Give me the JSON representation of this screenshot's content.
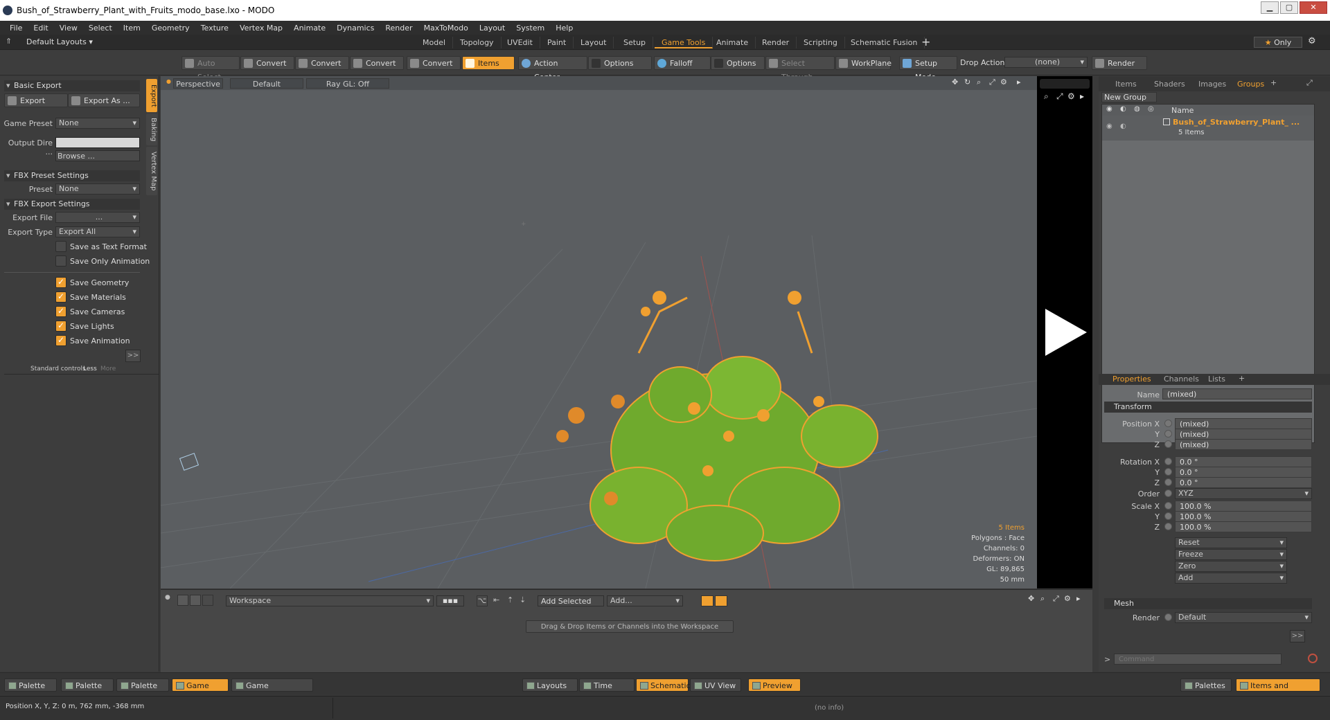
{
  "window": {
    "title": "Bush_of_Strawberry_Plant_with_Fruits_modo_base.lxo - MODO"
  },
  "menu": [
    "File",
    "Edit",
    "View",
    "Select",
    "Item",
    "Geometry",
    "Texture",
    "Vertex Map",
    "Animate",
    "Dynamics",
    "Render",
    "MaxToModo",
    "Layout",
    "System",
    "Help"
  ],
  "layouts": {
    "label": "Default Layouts",
    "tabs": [
      "Model",
      "Topology",
      "UVEdit",
      "Paint",
      "Layout",
      "Setup",
      "Game Tools",
      "Animate",
      "Render",
      "Scripting",
      "Schematic Fusion"
    ],
    "active": "Game Tools",
    "only": "Only"
  },
  "toolbar": {
    "auto_select": "Auto Select",
    "convert": "Convert",
    "items": "Items",
    "action_center": "Action Center",
    "options": "Options",
    "falloff": "Falloff",
    "select_through": "Select Through",
    "workplane": "WorkPlane",
    "setup_mode": "Setup Mode",
    "drop_action": "Drop Action",
    "drop_value": "(none)",
    "render": "Render ..."
  },
  "left": {
    "basic_export": "Basic Export",
    "export": "Export",
    "export_as": "Export As ...",
    "game_preset_label": "Game Preset",
    "game_preset_value": "None",
    "output_dir_label": "Output Dire ...",
    "browse": "Browse ...",
    "fbx_preset": "FBX Preset Settings",
    "preset_label": "Preset",
    "preset_value": "None",
    "fbx_export": "FBX Export Settings",
    "export_file_label": "Export File",
    "export_file_value": "...",
    "export_type_label": "Export Type",
    "export_type_value": "Export All",
    "checks": [
      {
        "label": "Save as Text Format",
        "on": false
      },
      {
        "label": "Save Only Animation",
        "on": false
      },
      {
        "label": "Save Geometry",
        "on": true
      },
      {
        "label": "Save Materials",
        "on": true
      },
      {
        "label": "Save Cameras",
        "on": true
      },
      {
        "label": "Save Lights",
        "on": true
      },
      {
        "label": "Save Animation",
        "on": true
      }
    ],
    "std_controls": "Standard controls",
    "less": "Less",
    "more": "More",
    "vtabs": [
      "Export",
      "Baking",
      "Vertex Map"
    ]
  },
  "viewport": {
    "perspective": "Perspective",
    "default": "Default",
    "raygl": "Ray GL: Off",
    "info": {
      "items": "5 Items",
      "polygons": "Polygons : Face",
      "channels": "Channels: 0",
      "deformers": "Deformers: ON",
      "gl": "GL: 89,865",
      "mm": "50 mm"
    }
  },
  "workspace": {
    "name": "Workspace",
    "add_selected": "Add Selected",
    "add": "Add...",
    "drag_hint": "Drag & Drop Items or Channels into the Workspace"
  },
  "groups": {
    "tabs": [
      "Items",
      "Shaders",
      "Images",
      "Groups"
    ],
    "new_group": "New Group",
    "name_header": "Name",
    "item_name": "Bush_of_Strawberry_Plant_ ...",
    "item_count": "5 Items"
  },
  "properties": {
    "tabs": [
      "Properties",
      "Channels",
      "Lists"
    ],
    "name_label": "Name",
    "name_value": "(mixed)",
    "transform": "Transform",
    "position": [
      "(mixed)",
      "(mixed)",
      "(mixed)"
    ],
    "rotation": [
      "0.0 °",
      "0.0 °",
      "0.0 °"
    ],
    "order": "XYZ",
    "scale": [
      "100.0 %",
      "100.0 %",
      "100.0 %"
    ],
    "actions": [
      "Reset",
      "Freeze",
      "Zero",
      "Add"
    ],
    "mesh": "Mesh",
    "render_label": "Render",
    "render_value": "Default",
    "command_placeholder": "Command",
    "labels": {
      "position_x": "Position X",
      "rotation_x": "Rotation X",
      "scale_x": "Scale X",
      "order": "Order",
      "y": "Y",
      "z": "Z"
    }
  },
  "bottom": {
    "palette": "Palette",
    "game_tools": "Game Tools",
    "game_navigation": "Game Navigation",
    "layouts": "Layouts",
    "time": "Time",
    "schematic": "Schematic",
    "uv_view": "UV View",
    "preview": "Preview",
    "palettes": "Palettes",
    "items_shading": "Items and Shading"
  },
  "status": {
    "position": "Position X, Y, Z:   0 m, 762 mm, -368 mm",
    "info": "(no info)"
  },
  "colors": {
    "accent": "#f0a030",
    "viewport_bg": "#5b5e61",
    "mesh_green": "#6faa2d"
  }
}
